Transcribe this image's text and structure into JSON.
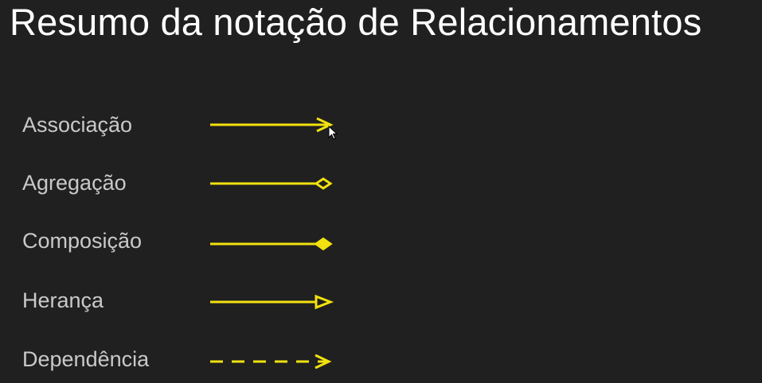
{
  "slide": {
    "title": "Resumo da notação de Relacionamentos",
    "background_color": "#202020",
    "title_color": "#ffffff",
    "label_color": "#c9c9c9",
    "line_color": "#f2e10f"
  },
  "relationships": [
    {
      "label": "Associação",
      "line": "solid",
      "end": "open-arrow",
      "icon": "association-arrow-icon"
    },
    {
      "label": "Agregação",
      "line": "solid",
      "end": "hollow-diamond",
      "icon": "aggregation-diamond-icon"
    },
    {
      "label": "Composição",
      "line": "solid",
      "end": "filled-diamond",
      "icon": "composition-diamond-icon"
    },
    {
      "label": "Herança",
      "line": "solid",
      "end": "hollow-triangle",
      "icon": "inheritance-triangle-icon"
    },
    {
      "label": "Dependência",
      "line": "dashed",
      "end": "open-arrow",
      "icon": "dependency-arrow-icon"
    }
  ]
}
